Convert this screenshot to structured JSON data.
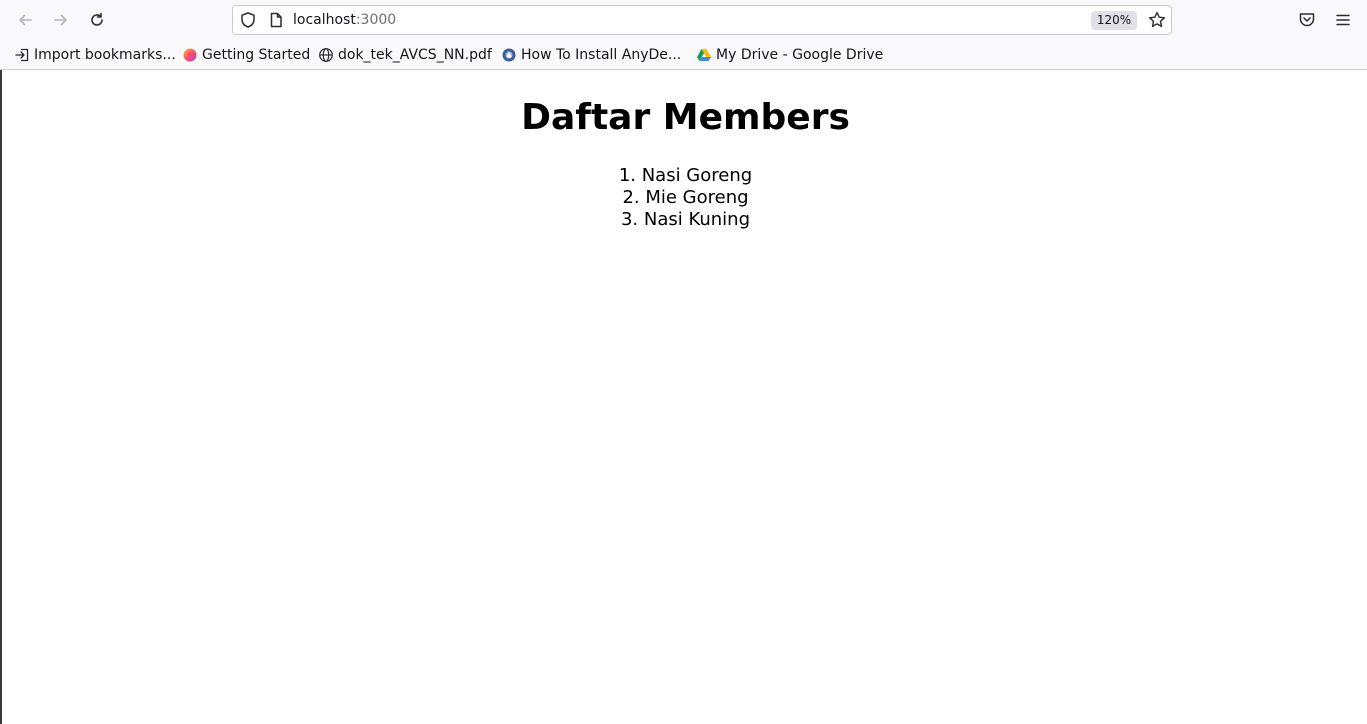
{
  "browser": {
    "url_host": "localhost",
    "url_port": ":3000",
    "zoom": "120%",
    "icons": {
      "back": "arrow-left-icon",
      "forward": "arrow-right-icon",
      "reload": "reload-icon",
      "shield": "shield-icon",
      "page": "page-icon",
      "star": "star-icon",
      "pocket": "pocket-icon",
      "menu": "hamburger-menu-icon"
    }
  },
  "bookmarks": [
    {
      "label": "Import bookmarks...",
      "icon": "import-icon"
    },
    {
      "label": "Getting Started",
      "icon": "firefox-icon"
    },
    {
      "label": "dok_tek_AVCS_NN.pdf",
      "icon": "globe-icon"
    },
    {
      "label": "How To Install AnyDe...",
      "icon": "site-favicon-icon"
    },
    {
      "label": "My Drive - Google Drive",
      "icon": "google-drive-icon"
    }
  ],
  "page": {
    "title": "Daftar Members",
    "members": [
      "1. Nasi Goreng",
      "2. Mie Goreng",
      "3. Nasi Kuning"
    ]
  }
}
